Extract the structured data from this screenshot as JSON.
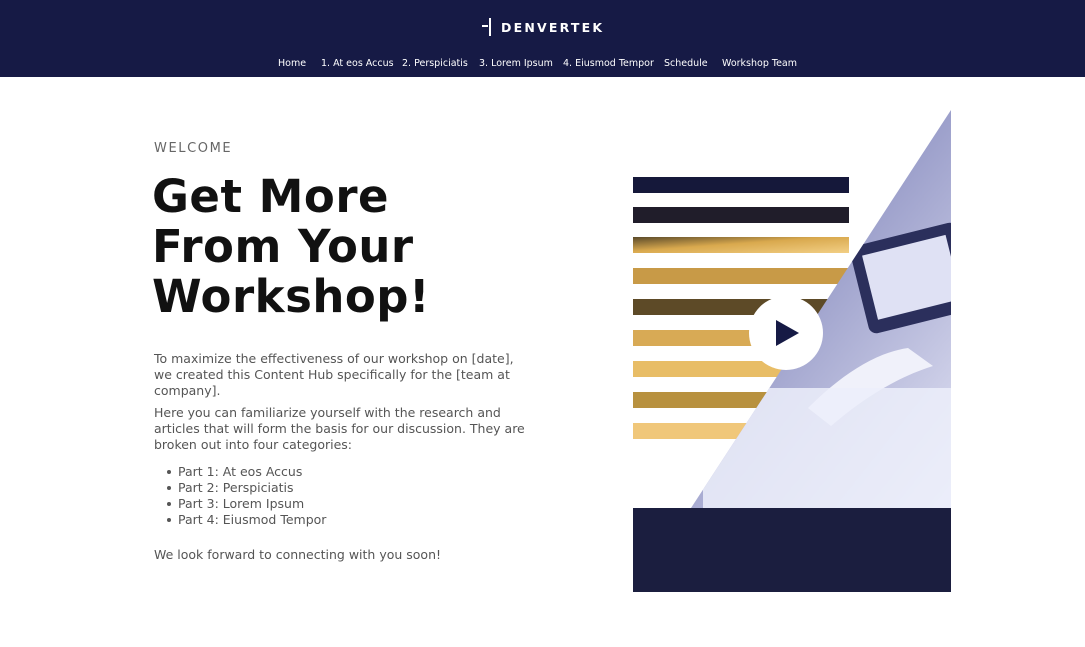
{
  "brand": {
    "name": "DENVERTEK",
    "logo_icon": "crosshair-logo-mark"
  },
  "nav": {
    "items": [
      "Home",
      "1. At eos Accus",
      "2. Perspiciatis",
      "3. Lorem Ipsum",
      "4. Eiusmod Tempor",
      "Schedule",
      "Workshop Team"
    ]
  },
  "hero": {
    "eyebrow": "WELCOME",
    "headline": [
      "Get More",
      "From Your",
      "Workshop!"
    ],
    "intro": "To maximize the effectiveness of our workshop on [date], we created this Content Hub specifically for the [team at company].",
    "details": "Here you can familiarize yourself with the research and articles that will form the basis for our discussion. They are broken out into four categories:",
    "parts": [
      "Part 1: At eos Accus",
      "Part 2: Perspiciatis",
      "Part 3: Lorem Ipsum",
      "Part 4: Eiusmod Tempor"
    ],
    "closing": "We look forward to connecting with you soon!"
  },
  "video": {
    "play_icon": "play-icon"
  },
  "colors": {
    "navy": "#161a45",
    "gold": "#e6b95a",
    "lavender": "#c9cbe8",
    "text": "#555555",
    "heading": "#111111"
  }
}
